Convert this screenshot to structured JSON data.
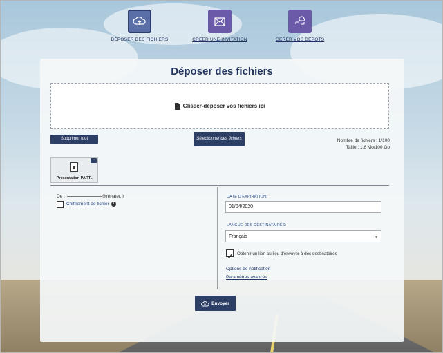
{
  "nav": {
    "items": [
      {
        "label": "DÉPOSER DES FICHIERS",
        "icon": "cloud-upload-icon",
        "active": true
      },
      {
        "label": "CRÉER UNE INVITATION",
        "icon": "envelope-invite-icon",
        "active": false
      },
      {
        "label": "GÉRER VOS DÉPÔTS",
        "icon": "cloud-manage-icon",
        "active": false
      }
    ]
  },
  "panel": {
    "title": "Déposer des fichiers",
    "dropzone_text": "Glisser-déposer vos fichiers ici",
    "delete_all_label": "Supprimer tout",
    "select_files_label": "Sélectionner des fichiers",
    "file_count": "Nombre de fichiers : 1/100",
    "file_size": "Taille : 1.6 Mo/100 Go",
    "file_name": "Présentation PART...",
    "from_label": "De :",
    "from_domain": "@renater.fr",
    "encryption_label": "Chiffrement de fichier",
    "expiration_label": "DATE D'EXPIRATION:",
    "expiration_value": "01/04/2020",
    "language_label": "LANGUE DES DESTINATAIRES:",
    "language_value": "Français",
    "get_link_label": "Obtenir un lien au lieu d'envoyer à des destinataires",
    "get_link_checked": true,
    "notification_options": "Options de notification",
    "advanced_settings": "Paramètres avancés",
    "send_label": "Envoyer"
  },
  "colors": {
    "accent": "#2e3f66",
    "nav_icon": "#6b5aa8",
    "link": "#203870"
  }
}
